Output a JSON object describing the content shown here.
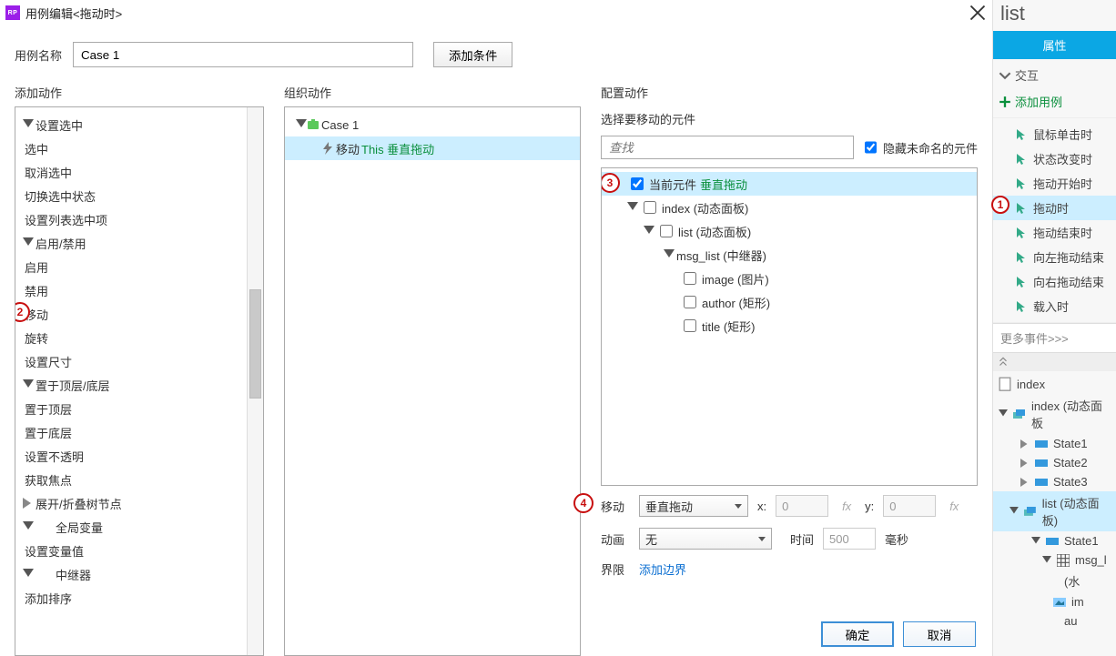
{
  "title": "用例编辑<拖动时>",
  "name_label": "用例名称",
  "case_name": "Case 1",
  "add_condition": "添加条件",
  "panels": {
    "add_actions": "添加动作",
    "organize": "组织动作",
    "configure": "配置动作"
  },
  "action_tree": {
    "set_selected_group": "设置选中",
    "select": "选中",
    "unselect": "取消选中",
    "toggle_select": "切换选中状态",
    "set_list_sel": "设置列表选中项",
    "enable_group": "启用/禁用",
    "enable": "启用",
    "disable": "禁用",
    "move": "移动",
    "rotate": "旋转",
    "resize": "设置尺寸",
    "z_group": "置于顶层/底层",
    "front": "置于顶层",
    "back": "置于底层",
    "opacity": "设置不透明",
    "focus": "获取焦点",
    "expand_tree": "展开/折叠树节点",
    "global_var": "全局变量",
    "set_var": "设置变量值",
    "repeater": "中继器",
    "add_sort": "添加排序"
  },
  "org_tree": {
    "case": "Case 1",
    "action": "移动",
    "action_detail": "This 垂直拖动"
  },
  "configure": {
    "select_widget": "选择要移动的元件",
    "search_placeholder": "查找",
    "hide_unnamed": "隐藏未命名的元件",
    "current": "当前元件",
    "current_detail": "垂直拖动",
    "index": "index (动态面板)",
    "list": "list (动态面板)",
    "msg_list": "msg_list (中继器)",
    "image": "image (图片)",
    "author": "author (矩形)",
    "title_w": "title (矩形)",
    "move_label": "移动",
    "move_type": "垂直拖动",
    "x_label": "x:",
    "x_value": "0",
    "y_label": "y:",
    "y_value": "0",
    "anim_label": "动画",
    "anim_type": "无",
    "time_label": "时间",
    "time_value": "500",
    "time_unit": "毫秒",
    "bound_label": "界限",
    "add_bound": "添加边界"
  },
  "buttons": {
    "ok": "确定",
    "cancel": "取消"
  },
  "rp": {
    "panel_title": "list",
    "tab": "属性",
    "interactions": "交互",
    "add_case": "添加用例",
    "events": {
      "click": "鼠标单击时",
      "state_change": "状态改变时",
      "drag_start": "拖动开始时",
      "dragging": "拖动时",
      "drag_end": "拖动结束时",
      "swipe_left": "向左拖动结束",
      "swipe_right": "向右拖动结束",
      "load": "载入时"
    },
    "more": "更多事件>>>",
    "outline": {
      "index_page": "index",
      "index_dp": "index (动态面板",
      "s1": "State1",
      "s2": "State2",
      "s3": "State3",
      "list_dp": "list (动态面板)",
      "list_s1": "State1",
      "msg": "msg_l",
      "water": "(水",
      "im": "im",
      "au": "au"
    }
  },
  "markers": {
    "1": "1",
    "2": "2",
    "3": "3",
    "4": "4"
  },
  "fx": "fx"
}
